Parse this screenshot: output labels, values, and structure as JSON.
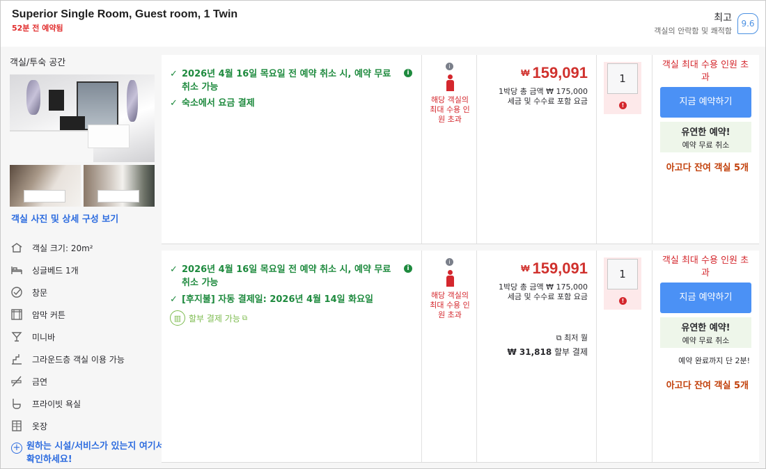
{
  "header": {
    "room_title": "Superior Single Room, Guest room, 1 Twin",
    "booked_recently": "52분 전 예약됨",
    "review_word": "최고",
    "review_sub": "객실의 안락함 및 쾌적함",
    "score": "9.6"
  },
  "left": {
    "section_title": "객실/투숙 공간",
    "view_photos": "객실 사진 및 상세 구성 보기",
    "amenities": [
      {
        "icon": "room-size-icon",
        "label": "객실 크기: 20m²"
      },
      {
        "icon": "bed-icon",
        "label": "싱글베드 1개"
      },
      {
        "icon": "window-icon",
        "label": "창문"
      },
      {
        "icon": "blackout-curtain-icon",
        "label": "암막 커튼"
      },
      {
        "icon": "minibar-icon",
        "label": "미니바"
      },
      {
        "icon": "ground-floor-icon",
        "label": "그라운드층 객실 이용 가능"
      },
      {
        "icon": "no-smoking-icon",
        "label": "금연"
      },
      {
        "icon": "private-bathroom-icon",
        "label": "프라이빗 욕실"
      },
      {
        "icon": "wardrobe-icon",
        "label": "옷장"
      }
    ],
    "more_facilities": "원하는 시설/서비스가 있는지 여기서 확인하세요!"
  },
  "offers": [
    {
      "conditions": [
        "2026년 4월 16일 목요일 전 예약 취소 시, 예약 무료 취소 가능",
        "숙소에서 요금 결제"
      ],
      "occupancy_text": "해당 객실의 최대 수용 인원 초과",
      "currency": "₩",
      "price": "159,091",
      "price_sub_1": "1박당 총 금액 ₩ 175,000",
      "price_sub_2": "세금 및 수수료 포함 요금",
      "quantity": "1",
      "occ_max": "객실 최대 수용 인원 초과",
      "book_label": "지금 예약하기",
      "flex_title": "유연한 예약!",
      "flex_sub": "예약 무료 취소",
      "rooms_left": "아고다 잔여 객실 5개"
    },
    {
      "conditions": [
        "2026년 4월 16일 목요일 전 예약 취소 시, 예약 무료 취소 가능",
        "[후지불] 자동 결제일: 2026년 4월 14일 화요일"
      ],
      "installment": "할부 결제 가능",
      "occupancy_text": "해당 객실의 최대 수용 인원 초과",
      "currency": "₩",
      "price": "159,091",
      "price_sub_1": "1박당 총 금액 ₩ 175,000",
      "price_sub_2": "세금 및 수수료 포함 요금",
      "lowest_monthly": "최저 월",
      "monthly_amount": "₩ 31,818",
      "monthly_suffix": "할부 결제",
      "quantity": "1",
      "occ_max": "객실 최대 수용 인원 초과",
      "book_label": "지금 예약하기",
      "flex_title": "유연한 예약!",
      "flex_sub": "예약 무료 취소",
      "until_complete": "예약 완료까지 단 2분!",
      "rooms_left": "아고다 잔여 객실 5개"
    }
  ]
}
